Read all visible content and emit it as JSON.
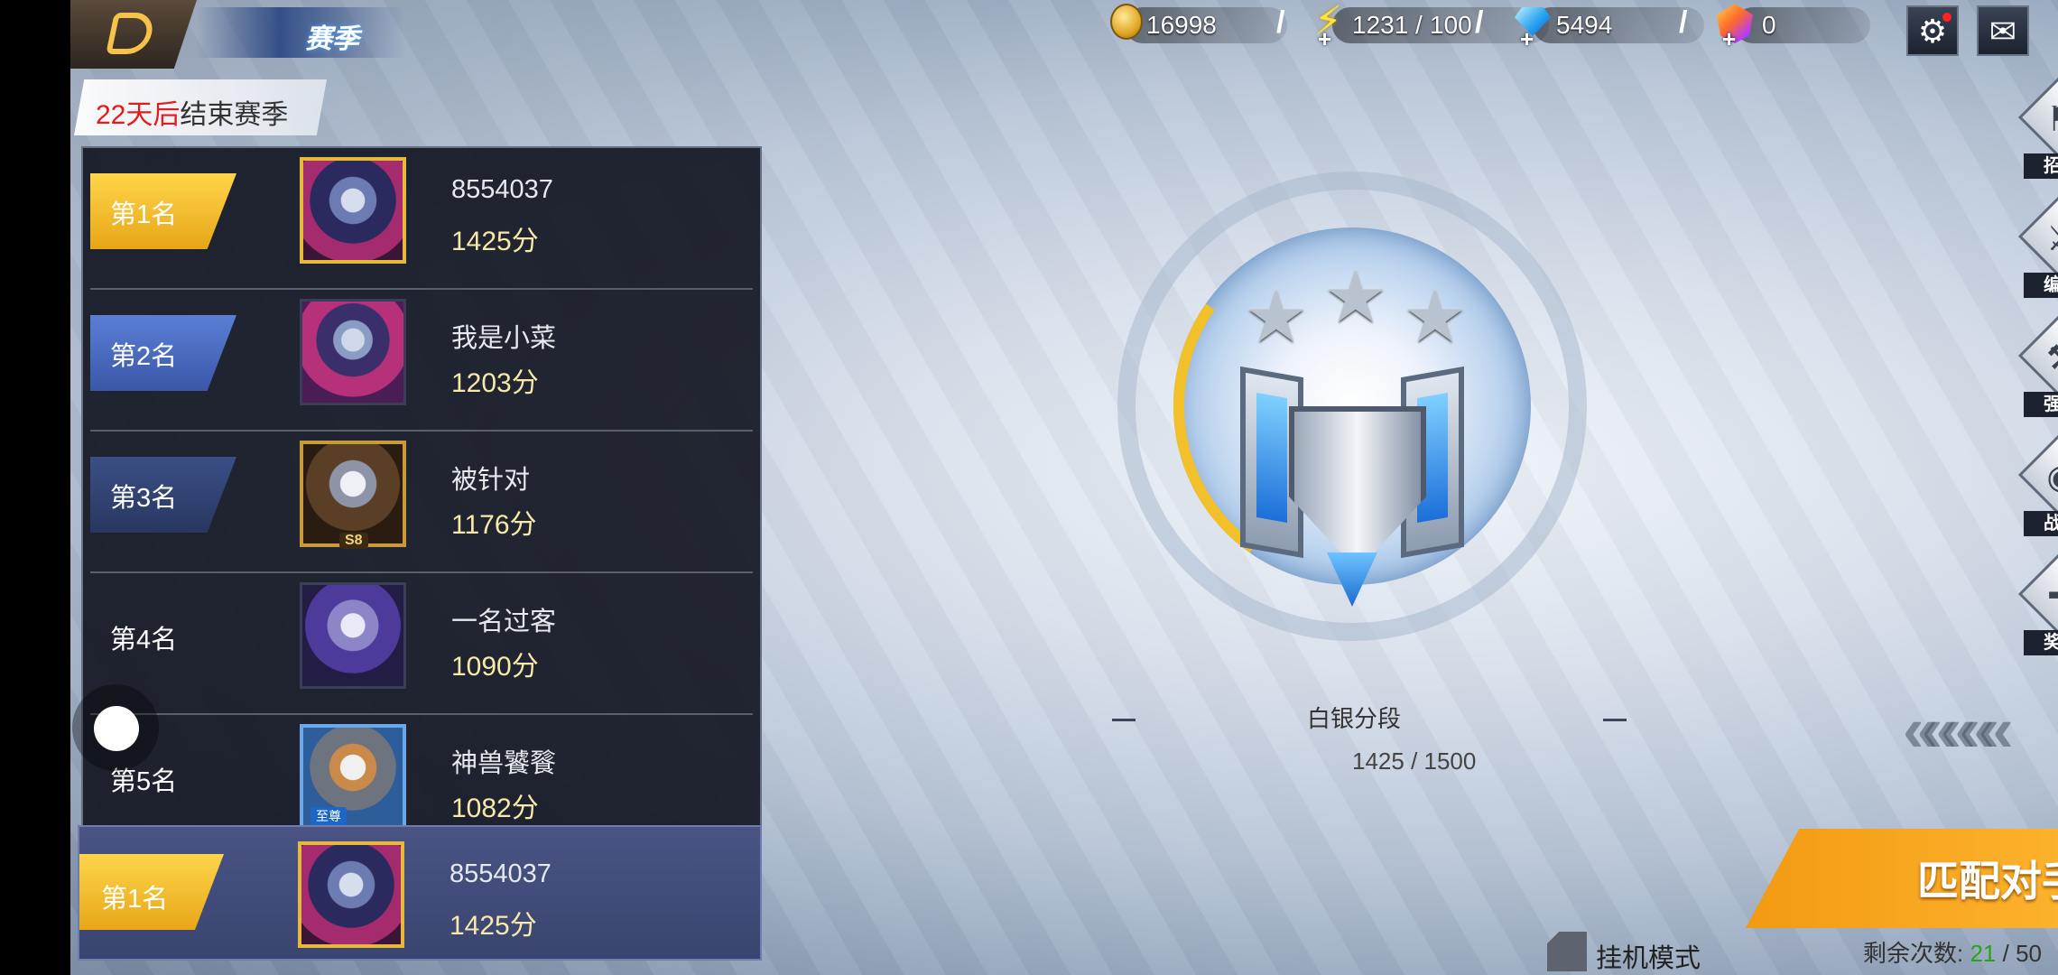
{
  "header": {
    "season_tab": "赛季",
    "gold": "16998",
    "energy": "1231",
    "energy_max": "100",
    "diamond": "5494",
    "crystal": "0",
    "plus": "+",
    "slash": "/"
  },
  "season": {
    "days": "22天后",
    "end_text": "结束赛季"
  },
  "leaderboard": [
    {
      "rank": "第1名",
      "name": "8554037",
      "score": "1425分"
    },
    {
      "rank": "第2名",
      "name": "我是小菜",
      "score": "1203分"
    },
    {
      "rank": "第3名",
      "name": "被针对",
      "score": "1176分",
      "badge": "S8"
    },
    {
      "rank": "第4名",
      "name": "一名过客",
      "score": "1090分"
    },
    {
      "rank": "第5名",
      "name": "神兽饕餮",
      "score": "1082分",
      "badge": "至尊"
    }
  ],
  "my_rank": {
    "rank": "第1名",
    "name": "8554037",
    "score": "1425分"
  },
  "tier": {
    "name": "白银分段",
    "score": "1425 / 1500",
    "stars": 3
  },
  "side_menu": [
    {
      "label": "招募",
      "icon": "recruit-icon"
    },
    {
      "label": "编队",
      "icon": "swords-icon"
    },
    {
      "label": "强化",
      "icon": "anvil-icon"
    },
    {
      "label": "战令",
      "icon": "battle-pass-icon"
    },
    {
      "label": "奖励",
      "icon": "gift-icon"
    }
  ],
  "match_button": "匹配对手",
  "remaining": {
    "label": "剩余次数:",
    "current": "21",
    "sep": " / ",
    "max": "50"
  },
  "idle_mode": "挂机模式",
  "colors": {
    "accent_gold": "#f2c028",
    "match_orange": "#f5a21a",
    "days_red": "#e41b1b"
  }
}
